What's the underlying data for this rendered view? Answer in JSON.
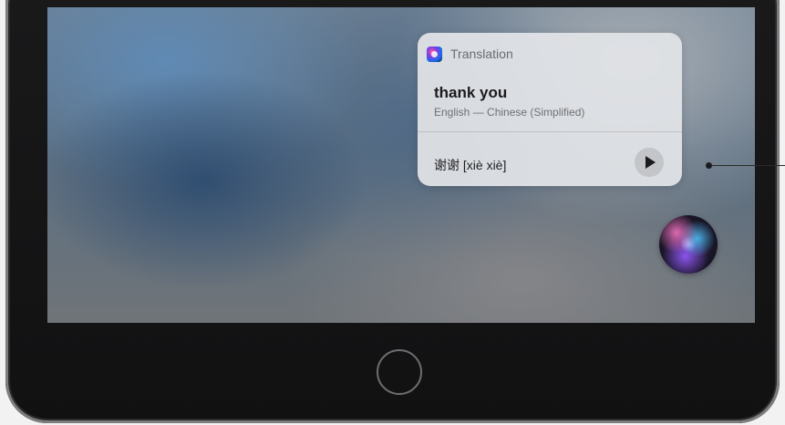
{
  "card": {
    "app_name": "Translation",
    "app_icon": "siri-icon",
    "phrase": "thank you",
    "languages": "English — Chinese (Simplified)",
    "translation": "谢谢 [xiè xiè]",
    "play_icon": "play-icon"
  },
  "siri": {
    "icon": "siri-orb-icon"
  },
  "device": {
    "home_button": "home-button"
  },
  "colors": {
    "card_background": "#e2e4e7",
    "phrase_text": "#1b1b1d",
    "secondary_text": "#6f7074",
    "bezel": "#111112"
  }
}
